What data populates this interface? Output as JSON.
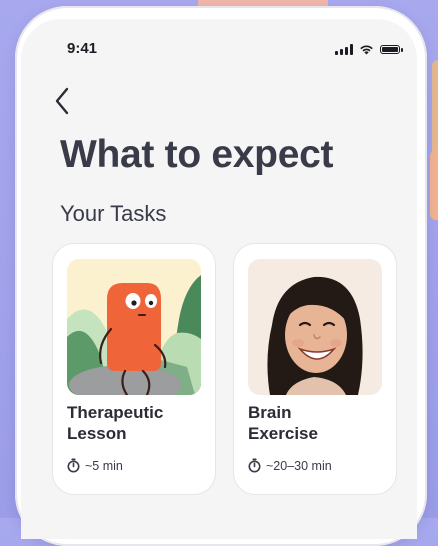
{
  "status_bar": {
    "time": "9:41"
  },
  "header": {
    "title": "What to expect"
  },
  "section": {
    "title": "Your Tasks"
  },
  "tasks": [
    {
      "title_line1": "Therapeutic",
      "title_line2": "Lesson",
      "duration": "~5 min",
      "icon": "timer-icon"
    },
    {
      "title_line1": "Brain",
      "title_line2": "Exercise",
      "duration": "~20–30 min",
      "icon": "timer-icon"
    }
  ],
  "colors": {
    "background": "#a3a4ec",
    "title": "#3a3b48",
    "card_border": "#e5e5ea",
    "character": "#f0643a"
  }
}
